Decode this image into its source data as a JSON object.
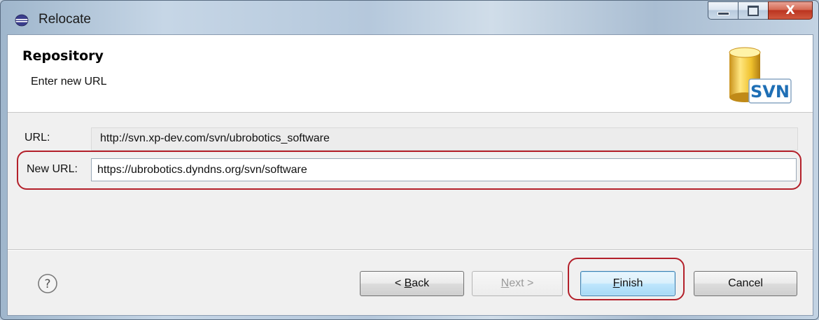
{
  "window": {
    "title": "Relocate",
    "app_icon": "eclipse-icon",
    "caption_buttons": {
      "minimize_icon": "minimize-icon",
      "maximize_icon": "maximize-icon",
      "close_glyph": "X"
    }
  },
  "header": {
    "title": "Repository",
    "description": "Enter new URL",
    "logo_text": "SVN"
  },
  "form": {
    "url_label": "URL:",
    "url_value": "http://svn.xp-dev.com/svn/ubrobotics_software",
    "new_url_label": "New URL:",
    "new_url_value": "https://ubrobotics.dyndns.org/svn/software"
  },
  "footer": {
    "help_icon": "help-icon",
    "help_glyph": "?",
    "back": {
      "prefix": "< ",
      "mnemonic": "B",
      "rest": "ack"
    },
    "next": {
      "mnemonic": "N",
      "rest": "ext >"
    },
    "finish": {
      "mnemonic": "F",
      "rest": "inish"
    },
    "cancel_label": "Cancel"
  },
  "colors": {
    "highlight": "#b3202a",
    "svn_blue": "#1f6fb5",
    "cylinder_gold": "#e8b923"
  }
}
